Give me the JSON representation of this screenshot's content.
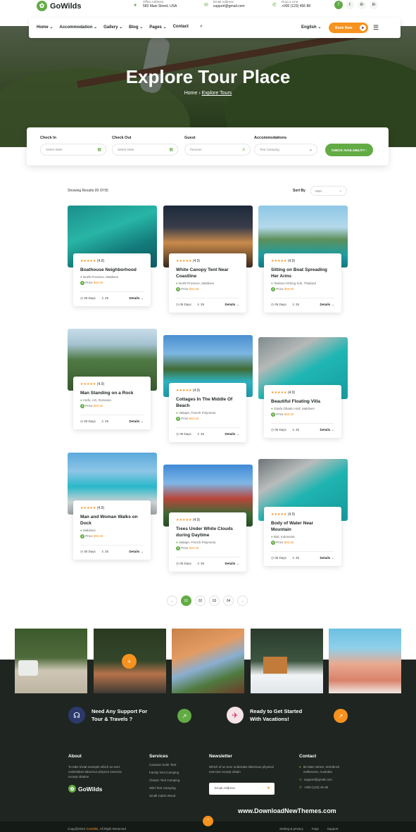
{
  "brand": {
    "name": "GoWilds",
    "accent": "#63ab45",
    "orange": "#f7921e",
    "dark": "#1f2621"
  },
  "contacts": [
    {
      "label": "Office Address",
      "value": "583 Main Street, USA",
      "icon": "map-pin-icon"
    },
    {
      "label": "Email Address",
      "value": "support@gmail.com",
      "icon": "mail-icon"
    },
    {
      "label": "Drop a Line",
      "value": "+000 (123) 456 88",
      "icon": "phone-icon"
    }
  ],
  "social": [
    "f",
    "t",
    "in",
    "in"
  ],
  "nav": {
    "items": [
      "Home",
      "Accommodation",
      "Gallery",
      "Blog",
      "Pages",
      "Contact"
    ],
    "language": "English",
    "book_label": "Book Now"
  },
  "hero": {
    "title": "Explore Tour Place",
    "crumb_home": "Home",
    "crumb_current": "Explore Tours"
  },
  "search": {
    "fields": [
      {
        "label": "Check In",
        "placeholder": "Select Date",
        "icon": "calendar-icon"
      },
      {
        "label": "Check Out",
        "placeholder": "Select Date",
        "icon": "calendar-icon"
      },
      {
        "label": "Guest",
        "placeholder": "Persons",
        "icon": "user-icon"
      },
      {
        "label": "Accommodations",
        "placeholder": "Tent Camping",
        "icon": "chevron-down-icon"
      }
    ],
    "button": "CHECK AVAILABILITY"
  },
  "results": {
    "count": "Showing Results 09 Of 55",
    "sort_label": "Sort By",
    "sort_value": "USA"
  },
  "tours": [
    {
      "title": "Boathouse Neighborhood",
      "location": "North Province, Maldives",
      "price": "$93.65",
      "rating": "(4.9)",
      "days": "05 Days",
      "people": "25"
    },
    {
      "title": "White Canopy Tent Near Coastline",
      "location": "North Province, Maldives",
      "price": "$93.65",
      "rating": "(4.9)",
      "days": "05 Days",
      "people": "25"
    },
    {
      "title": "Sitting on Boat Spreading Her Arms",
      "location": "Tambon Khlong Sok, Thailand",
      "price": "$93.65",
      "rating": "(4.9)",
      "days": "05 Days",
      "people": "25"
    },
    {
      "title": "Man Standing on a Rock",
      "location": "Arefu, AG, Romania",
      "price": "$93.65",
      "rating": "(4.9)",
      "days": "05 Days",
      "people": "25"
    },
    {
      "title": "Cottages In The Middle Of Beach",
      "location": "Vaitape, French Polynesia",
      "price": "$93.65",
      "rating": "(4.9)",
      "days": "05 Days",
      "people": "25"
    },
    {
      "title": "Beautiful Floating Villa",
      "location": "Gaafu Dhaalu Atoll, Maldives",
      "price": "$93.65",
      "rating": "(4.9)",
      "days": "05 Days",
      "people": "25"
    },
    {
      "title": "Man and Woman Walks on Dock",
      "location": "Maldives",
      "price": "$93.65",
      "rating": "(4.9)",
      "days": "05 Days",
      "people": "25"
    },
    {
      "title": "Trees Under White Clouds during Daytime",
      "location": "Vaitape, French Polynesia",
      "price": "$93.65",
      "rating": "(4.9)",
      "days": "05 Days",
      "people": "25"
    },
    {
      "title": "Body of Water Near Mountain",
      "location": "Bali, Indonesia",
      "price": "$93.65",
      "rating": "(4.9)",
      "days": "05 Days",
      "people": "25"
    }
  ],
  "details_label": "Details",
  "stars": "★★★★★",
  "price_prefix": "Price",
  "pagination": [
    "←",
    "01",
    "02",
    "03",
    "04",
    "→"
  ],
  "support": [
    {
      "title": "Need Any Support For",
      "sub": "Tour & Travels ?"
    },
    {
      "title": "Ready to Get Started",
      "sub": "With Vacations!"
    }
  ],
  "footer": {
    "about_head": "About",
    "about_text": "To take trivial example which us ever undertakes laborious physics exercise except obtaine",
    "services_head": "Services",
    "services": [
      "Caravan Soler Tent",
      "Family Tent Camping",
      "Classic Tent Camping",
      "Wild Tent Camping",
      "Small Cabin Wood"
    ],
    "news_head": "Newsletter",
    "news_text": "Which of us ever undertake laborious physical exercise except obtain",
    "email_placeholder": "Email Address",
    "contact_head": "Contact",
    "contact_addr": "55 Main Street, 2nd Block melbourne, Australia",
    "contact_email": "support@gmail.com",
    "contact_phone": "+000 (123) 45 66",
    "watermark": "www.DownloadNewThemes.com",
    "copy_pre": "Copy@2022",
    "copy_brand": "GoWilds",
    "copy_post": ", All Right Reserved",
    "links": [
      "Setting & privacy",
      "Faqs",
      "Support"
    ]
  }
}
